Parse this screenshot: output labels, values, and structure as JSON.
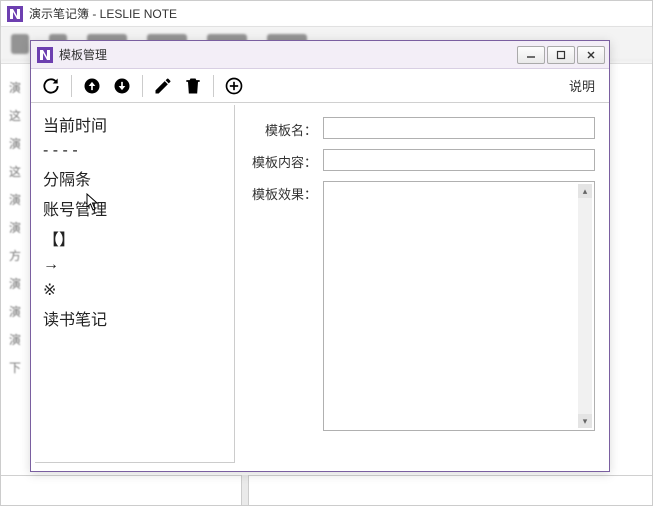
{
  "parent": {
    "title": "演示笔记簿 - LESLIE NOTE"
  },
  "dialog": {
    "title": "模板管理",
    "help_label": "说明"
  },
  "toolbar": {
    "refresh": "refresh",
    "up": "move-up",
    "down": "move-down",
    "edit": "edit",
    "delete": "delete",
    "add": "add"
  },
  "templates": [
    "当前时间",
    "- - - -",
    "分隔条",
    "账号管理",
    "【】",
    "→",
    "※",
    "读书笔记"
  ],
  "form": {
    "name_label": "模板名：",
    "content_label": "模板内容：",
    "effect_label": "模板效果：",
    "name_value": "",
    "content_value": ""
  },
  "window_controls": {
    "min": "minimize",
    "max": "maximize",
    "close": "close"
  }
}
